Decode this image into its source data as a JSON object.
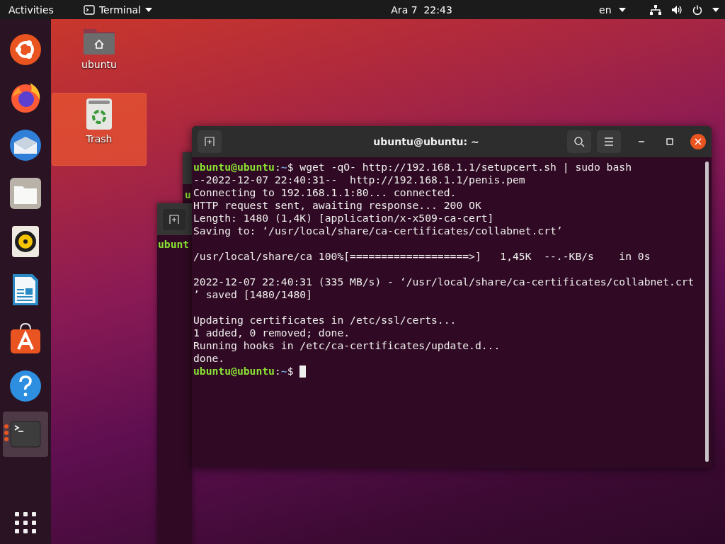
{
  "top_bar": {
    "activities": "Activities",
    "app_menu": "Terminal",
    "clock": "Ara 7  22:43",
    "keyboard_layout": "en"
  },
  "dock": {
    "items": [
      {
        "kind": "ubuntu",
        "active": false
      },
      {
        "kind": "browser",
        "active": false
      },
      {
        "kind": "mail",
        "active": false
      },
      {
        "kind": "files",
        "active": false
      },
      {
        "kind": "music",
        "active": false
      },
      {
        "kind": "writer",
        "active": false
      },
      {
        "kind": "software",
        "active": false
      },
      {
        "kind": "help",
        "active": false
      },
      {
        "kind": "terminal",
        "active": true
      }
    ]
  },
  "desktop_icons": [
    {
      "kind": "home",
      "label": "ubuntu",
      "selected": false
    },
    {
      "kind": "trash",
      "label": "Trash",
      "selected": true
    }
  ],
  "background_windows": [
    {
      "fragment": "u"
    },
    {
      "fragment": "ubunt"
    }
  ],
  "terminal": {
    "title": "ubuntu@ubuntu: ~",
    "lines": [
      {
        "kind": "prompt",
        "user": "ubuntu@ubuntu",
        "separator": ":",
        "path": "~",
        "symbol": "$",
        "command": "wget -qO- http://192.168.1.1/setupcert.sh | sudo bash"
      },
      {
        "kind": "output",
        "text": "--2022-12-07 22:40:31--  http://192.168.1.1/penis.pem"
      },
      {
        "kind": "output",
        "text": "Connecting to 192.168.1.1:80... connected."
      },
      {
        "kind": "output",
        "text": "HTTP request sent, awaiting response... 200 OK"
      },
      {
        "kind": "output",
        "text": "Length: 1480 (1,4K) [application/x-x509-ca-cert]"
      },
      {
        "kind": "output",
        "text": "Saving to: ‘/usr/local/share/ca-certificates/collabnet.crt’"
      },
      {
        "kind": "blank"
      },
      {
        "kind": "output",
        "text": "/usr/local/share/ca 100%[===================>]   1,45K  --.-KB/s    in 0s"
      },
      {
        "kind": "blank"
      },
      {
        "kind": "output",
        "text": "2022-12-07 22:40:31 (335 MB/s) - ‘/usr/local/share/ca-certificates/collabnet.crt"
      },
      {
        "kind": "output",
        "text": "’ saved [1480/1480]"
      },
      {
        "kind": "blank"
      },
      {
        "kind": "output",
        "text": "Updating certificates in /etc/ssl/certs..."
      },
      {
        "kind": "output",
        "text": "1 added, 0 removed; done."
      },
      {
        "kind": "output",
        "text": "Running hooks in /etc/ca-certificates/update.d..."
      },
      {
        "kind": "output",
        "text": "done."
      },
      {
        "kind": "prompt",
        "user": "ubuntu@ubuntu",
        "separator": ":",
        "path": "~",
        "symbol": "$",
        "cursor": true
      }
    ]
  }
}
